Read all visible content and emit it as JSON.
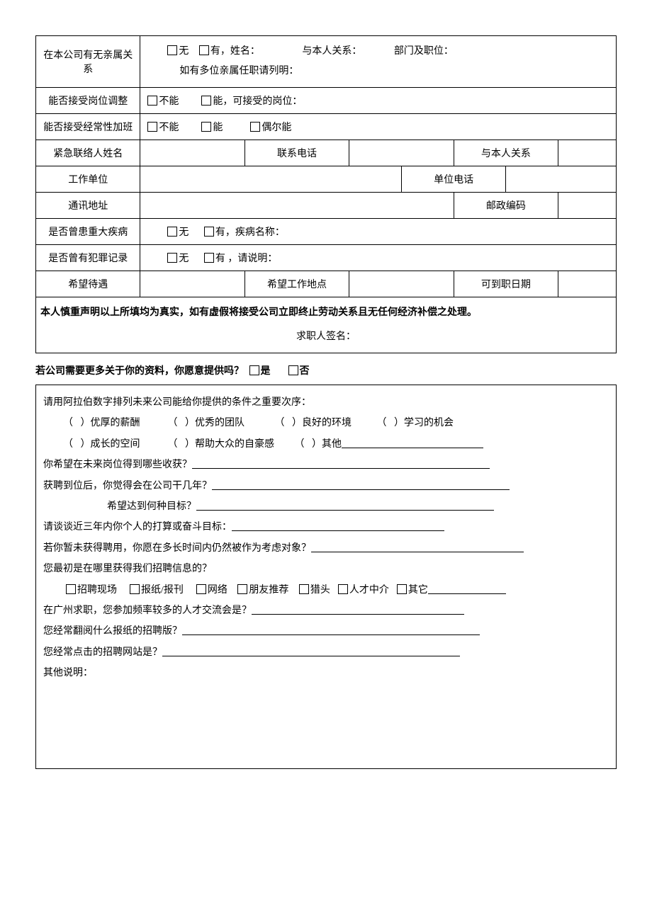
{
  "table": {
    "relatives": {
      "label": "在本公司有无亲属关系",
      "none": "无",
      "has": "有，姓名：",
      "relation": "与本人关系：",
      "dept": "部门及职位：",
      "multi": "如有多位亲属任职请列明："
    },
    "jobAdjust": {
      "label": "能否接受岗位调整",
      "no": "不能",
      "yes": "能，可接受的岗位："
    },
    "overtime": {
      "label": "能否接受经常性加班",
      "no": "不能",
      "yes": "能",
      "sometimes": "偶尔能"
    },
    "emergency": {
      "name": "紧急联络人姓名",
      "phone": "联系电话",
      "relation": "与本人关系"
    },
    "work": {
      "unit": "工作单位",
      "tel": "单位电话"
    },
    "addr": {
      "label": "通讯地址",
      "zip": "邮政编码"
    },
    "illness": {
      "label": "是否曾患重大疾病",
      "none": "无",
      "has": "有，疾病名称："
    },
    "crime": {
      "label": "是否曾有犯罪记录",
      "none": "无",
      "has": "有 ，请说明："
    },
    "expect": {
      "salary": "希望待遇",
      "location": "希望工作地点",
      "startDate": "可到职日期"
    },
    "declaration": "本人慎重声明以上所填均为真实，如有虚假将接受公司立即终止劳动关系且无任何经济补偿之处理。",
    "signature": "求职人签名："
  },
  "midQuestion": {
    "text": "若公司需要更多关于你的资料，你愿意提供吗？",
    "yes": "是",
    "no": "否"
  },
  "box": {
    "rankIntro": "请用阿拉伯数字排列未来公司能给你提供的条件之重要次序：",
    "opts": {
      "a": "优厚的薪酬",
      "b": "优秀的团队",
      "c": "良好的环境",
      "d": "学习的机会",
      "e": "成长的空间",
      "f": "帮助大众的自豪感",
      "g": "其他"
    },
    "q_gain": "你希望在未来岗位得到哪些收获？",
    "q_years": "获聘到位后，你觉得会在公司干几年？",
    "q_goal": "希望达到何种目标？",
    "q_plan": "请谈谈近三年内你个人的打算或奋斗目标：",
    "q_wait": "若你暂未获得聘用，你愿在多长时间内仍然被作为考虑对象？",
    "q_source": "您最初是在哪里获得我们招聘信息的？",
    "src": {
      "a": "招聘现场",
      "b": "报纸/报刊",
      "c": "网络",
      "d": "朋友推荐",
      "e": "猎头",
      "f": "人才中介",
      "g": "其它"
    },
    "q_fair": "在广州求职，您参加频率较多的人才交流会是？",
    "q_paper": "您经常翻阅什么报纸的招聘版？",
    "q_site": "您经常点击的招聘网站是？",
    "q_other": "其他说明："
  }
}
